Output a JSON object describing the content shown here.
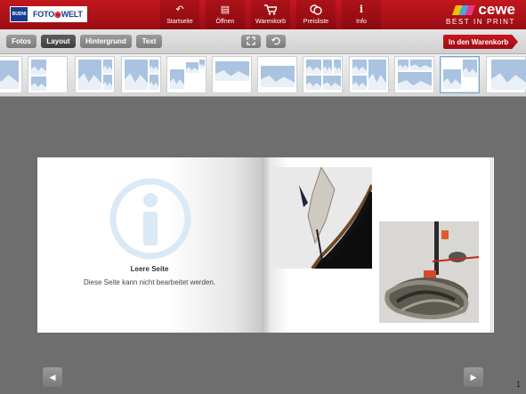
{
  "header": {
    "logo_badge": "BUDNI",
    "logo_foto": "FOTO",
    "logo_welt": "WELT",
    "nav": [
      {
        "label": "Startseite",
        "icon": "home-icon"
      },
      {
        "label": "Öffnen",
        "icon": "open-folder-icon"
      },
      {
        "label": "Warenkorb",
        "icon": "cart-icon"
      },
      {
        "label": "Preisliste",
        "icon": "coins-icon"
      },
      {
        "label": "Info",
        "icon": "info-icon"
      }
    ],
    "brand_name": "cewe",
    "brand_tagline": "BEST IN PRINT"
  },
  "toolbar": {
    "tabs": [
      "Fotos",
      "Layout",
      "Hintergrund",
      "Text"
    ],
    "active_tab": "Layout",
    "cart_button": "In den Warenkorb"
  },
  "page": {
    "empty_title": "Leere Seite",
    "empty_description": "Diese Seite kann nicht bearbeitet werden.",
    "page_number": "1"
  },
  "colors": {
    "brand_red": "#c3171f",
    "placeholder_blue": "#a9c3e0",
    "background_gray": "#6e6e6e"
  }
}
